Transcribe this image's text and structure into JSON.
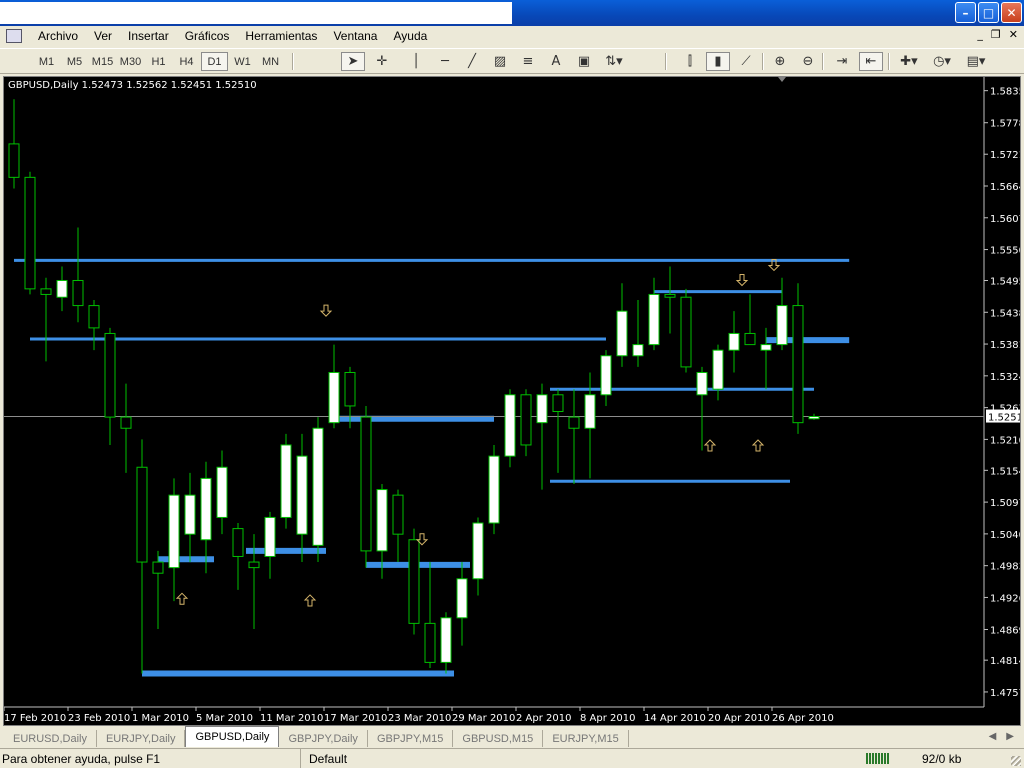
{
  "window": {
    "controls": [
      "minimize-icon",
      "maximize-icon",
      "close-icon"
    ]
  },
  "menu": [
    "Archivo",
    "Ver",
    "Insertar",
    "Gráficos",
    "Herramientas",
    "Ventana",
    "Ayuda"
  ],
  "timeframes": [
    "M1",
    "M5",
    "M15",
    "M30",
    "H1",
    "H4",
    "D1",
    "W1",
    "MN"
  ],
  "active_timeframe": "D1",
  "chart_info": "GBPUSD,Daily  1.52473 1.52562 1.52451 1.52510",
  "chart_data": {
    "type": "candlestick",
    "symbol": "GBPUSD",
    "timeframe": "Daily",
    "colors": {
      "background": "#000000",
      "bull_body": "#ffffff",
      "wick": "#00c000",
      "level": "#3d8fe6",
      "arrow": "#d4b46a",
      "axis_text": "#ffffff",
      "bid_line": "#8c8c8c"
    },
    "ylim": [
      1.473,
      1.586
    ],
    "price_ticks": [
      "1.58355",
      "1.57780",
      "1.57215",
      "1.56645",
      "1.56075",
      "1.55505",
      "1.54950",
      "1.54380",
      "1.53810",
      "1.53240",
      "1.52670",
      "1.52100",
      "1.51545",
      "1.50975",
      "1.50405",
      "1.49835",
      "1.49265",
      "1.48690",
      "1.48140",
      "1.47570"
    ],
    "current_price": "1.52510",
    "date_labels": [
      {
        "label": "17 Feb 2010",
        "index": 0
      },
      {
        "label": "23 Feb 2010",
        "index": 4
      },
      {
        "label": "1 Mar 2010",
        "index": 8
      },
      {
        "label": "5 Mar 2010",
        "index": 12
      },
      {
        "label": "11 Mar 2010",
        "index": 16
      },
      {
        "label": "17 Mar 2010",
        "index": 20
      },
      {
        "label": "23 Mar 2010",
        "index": 24
      },
      {
        "label": "29 Mar 2010",
        "index": 28
      },
      {
        "label": "2 Apr 2010",
        "index": 32
      },
      {
        "label": "8 Apr 2010",
        "index": 36
      },
      {
        "label": "14 Apr 2010",
        "index": 40
      },
      {
        "label": "20 Apr 2010",
        "index": 44
      },
      {
        "label": "26 Apr 2010",
        "index": 48
      }
    ],
    "candles": [
      {
        "o": 1.574,
        "h": 1.582,
        "l": 1.566,
        "c": 1.568
      },
      {
        "o": 1.568,
        "h": 1.569,
        "l": 1.547,
        "c": 1.548
      },
      {
        "o": 1.548,
        "h": 1.55,
        "l": 1.535,
        "c": 1.547
      },
      {
        "o": 1.5465,
        "h": 1.552,
        "l": 1.544,
        "c": 1.5495
      },
      {
        "o": 1.5495,
        "h": 1.559,
        "l": 1.542,
        "c": 1.545
      },
      {
        "o": 1.545,
        "h": 1.546,
        "l": 1.537,
        "c": 1.541
      },
      {
        "o": 1.54,
        "h": 1.541,
        "l": 1.52,
        "c": 1.525
      },
      {
        "o": 1.525,
        "h": 1.531,
        "l": 1.515,
        "c": 1.523
      },
      {
        "o": 1.516,
        "h": 1.521,
        "l": 1.479,
        "c": 1.499
      },
      {
        "o": 1.499,
        "h": 1.501,
        "l": 1.487,
        "c": 1.497
      },
      {
        "o": 1.498,
        "h": 1.514,
        "l": 1.492,
        "c": 1.511
      },
      {
        "o": 1.504,
        "h": 1.515,
        "l": 1.499,
        "c": 1.511
      },
      {
        "o": 1.503,
        "h": 1.517,
        "l": 1.497,
        "c": 1.514
      },
      {
        "o": 1.507,
        "h": 1.519,
        "l": 1.504,
        "c": 1.516
      },
      {
        "o": 1.505,
        "h": 1.506,
        "l": 1.494,
        "c": 1.5
      },
      {
        "o": 1.499,
        "h": 1.504,
        "l": 1.487,
        "c": 1.498
      },
      {
        "o": 1.5,
        "h": 1.508,
        "l": 1.496,
        "c": 1.507
      },
      {
        "o": 1.507,
        "h": 1.522,
        "l": 1.505,
        "c": 1.52
      },
      {
        "o": 1.504,
        "h": 1.522,
        "l": 1.499,
        "c": 1.518
      },
      {
        "o": 1.502,
        "h": 1.525,
        "l": 1.499,
        "c": 1.523
      },
      {
        "o": 1.524,
        "h": 1.538,
        "l": 1.523,
        "c": 1.533
      },
      {
        "o": 1.533,
        "h": 1.534,
        "l": 1.523,
        "c": 1.527
      },
      {
        "o": 1.525,
        "h": 1.527,
        "l": 1.498,
        "c": 1.501
      },
      {
        "o": 1.501,
        "h": 1.513,
        "l": 1.496,
        "c": 1.512
      },
      {
        "o": 1.511,
        "h": 1.512,
        "l": 1.499,
        "c": 1.504
      },
      {
        "o": 1.503,
        "h": 1.505,
        "l": 1.486,
        "c": 1.488
      },
      {
        "o": 1.488,
        "h": 1.499,
        "l": 1.48,
        "c": 1.481
      },
      {
        "o": 1.481,
        "h": 1.49,
        "l": 1.479,
        "c": 1.489
      },
      {
        "o": 1.489,
        "h": 1.499,
        "l": 1.484,
        "c": 1.496
      },
      {
        "o": 1.496,
        "h": 1.507,
        "l": 1.493,
        "c": 1.506
      },
      {
        "o": 1.506,
        "h": 1.52,
        "l": 1.504,
        "c": 1.518
      },
      {
        "o": 1.518,
        "h": 1.53,
        "l": 1.516,
        "c": 1.529
      },
      {
        "o": 1.529,
        "h": 1.53,
        "l": 1.518,
        "c": 1.52
      },
      {
        "o": 1.524,
        "h": 1.531,
        "l": 1.512,
        "c": 1.529
      },
      {
        "o": 1.529,
        "h": 1.53,
        "l": 1.515,
        "c": 1.526
      },
      {
        "o": 1.525,
        "h": 1.53,
        "l": 1.513,
        "c": 1.523
      },
      {
        "o": 1.523,
        "h": 1.533,
        "l": 1.514,
        "c": 1.529
      },
      {
        "o": 1.529,
        "h": 1.537,
        "l": 1.527,
        "c": 1.536
      },
      {
        "o": 1.536,
        "h": 1.549,
        "l": 1.534,
        "c": 1.544
      },
      {
        "o": 1.536,
        "h": 1.546,
        "l": 1.534,
        "c": 1.538
      },
      {
        "o": 1.538,
        "h": 1.55,
        "l": 1.537,
        "c": 1.547
      },
      {
        "o": 1.547,
        "h": 1.552,
        "l": 1.54,
        "c": 1.5465
      },
      {
        "o": 1.5465,
        "h": 1.548,
        "l": 1.533,
        "c": 1.534
      },
      {
        "o": 1.529,
        "h": 1.534,
        "l": 1.519,
        "c": 1.533
      },
      {
        "o": 1.53,
        "h": 1.538,
        "l": 1.528,
        "c": 1.537
      },
      {
        "o": 1.537,
        "h": 1.544,
        "l": 1.533,
        "c": 1.54
      },
      {
        "o": 1.54,
        "h": 1.547,
        "l": 1.538,
        "c": 1.538
      },
      {
        "o": 1.537,
        "h": 1.541,
        "l": 1.53,
        "c": 1.538
      },
      {
        "o": 1.538,
        "h": 1.55,
        "l": 1.537,
        "c": 1.545
      },
      {
        "o": 1.545,
        "h": 1.549,
        "l": 1.522,
        "c": 1.524
      },
      {
        "o": 1.5247,
        "h": 1.5256,
        "l": 1.5245,
        "c": 1.5251
      }
    ],
    "levels": [
      {
        "price": 1.5531,
        "from": 0,
        "to": 52.2,
        "thick": false
      },
      {
        "price": 1.539,
        "from": 1,
        "to": 37,
        "thick": false
      },
      {
        "price": 1.5388,
        "from": 47,
        "to": 52.2,
        "thick": true
      },
      {
        "price": 1.5475,
        "from": 40,
        "to": 48,
        "thick": false
      },
      {
        "price": 1.53,
        "from": 33.5,
        "to": 50,
        "thick": false
      },
      {
        "price": 1.5247,
        "from": 20,
        "to": 30,
        "thick": true
      },
      {
        "price": 1.5135,
        "from": 33.5,
        "to": 48.5,
        "thick": false
      },
      {
        "price": 1.4995,
        "from": 9,
        "to": 12.5,
        "thick": true
      },
      {
        "price": 1.501,
        "from": 14.5,
        "to": 19.5,
        "thick": true
      },
      {
        "price": 1.4985,
        "from": 22,
        "to": 28.5,
        "thick": true
      },
      {
        "price": 1.479,
        "from": 8,
        "to": 27.5,
        "thick": true
      }
    ],
    "arrows": [
      {
        "index": 19.5,
        "price": 1.544,
        "dir": "down"
      },
      {
        "index": 25.5,
        "price": 1.503,
        "dir": "down"
      },
      {
        "index": 45.5,
        "price": 1.5495,
        "dir": "down"
      },
      {
        "index": 47.5,
        "price": 1.5522,
        "dir": "down"
      },
      {
        "index": 10.5,
        "price": 1.4925,
        "dir": "up"
      },
      {
        "index": 18.5,
        "price": 1.4922,
        "dir": "up"
      },
      {
        "index": 43.5,
        "price": 1.52,
        "dir": "up"
      },
      {
        "index": 46.5,
        "price": 1.52,
        "dir": "up"
      }
    ]
  },
  "tabs": [
    "EURUSD,Daily",
    "EURJPY,Daily",
    "GBPUSD,Daily",
    "GBPJPY,Daily",
    "GBPJPY,M15",
    "GBPUSD,M15",
    "EURJPY,M15"
  ],
  "active_tab": "GBPUSD,Daily",
  "status": {
    "help": "Para obtener ayuda, pulse F1",
    "profile": "Default",
    "traffic": "92/0 kb"
  }
}
